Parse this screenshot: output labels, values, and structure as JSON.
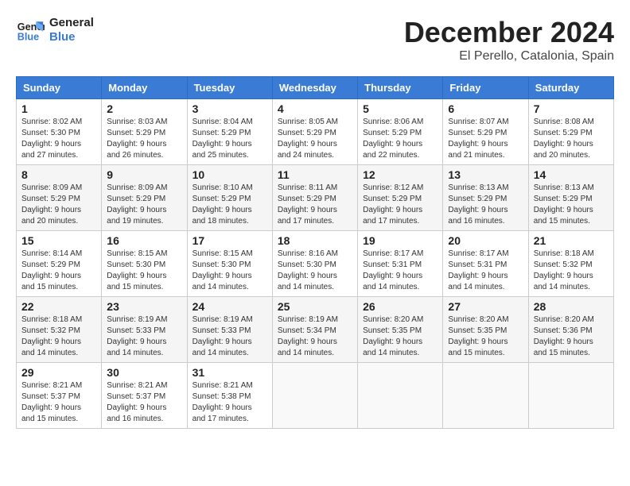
{
  "logo": {
    "line1": "General",
    "line2": "Blue"
  },
  "header": {
    "month": "December 2024",
    "location": "El Perello, Catalonia, Spain"
  },
  "weekdays": [
    "Sunday",
    "Monday",
    "Tuesday",
    "Wednesday",
    "Thursday",
    "Friday",
    "Saturday"
  ],
  "weeks": [
    [
      {
        "day": "1",
        "sunrise": "8:02 AM",
        "sunset": "5:30 PM",
        "daylight": "9 hours and 27 minutes."
      },
      {
        "day": "2",
        "sunrise": "8:03 AM",
        "sunset": "5:29 PM",
        "daylight": "9 hours and 26 minutes."
      },
      {
        "day": "3",
        "sunrise": "8:04 AM",
        "sunset": "5:29 PM",
        "daylight": "9 hours and 25 minutes."
      },
      {
        "day": "4",
        "sunrise": "8:05 AM",
        "sunset": "5:29 PM",
        "daylight": "9 hours and 24 minutes."
      },
      {
        "day": "5",
        "sunrise": "8:06 AM",
        "sunset": "5:29 PM",
        "daylight": "9 hours and 22 minutes."
      },
      {
        "day": "6",
        "sunrise": "8:07 AM",
        "sunset": "5:29 PM",
        "daylight": "9 hours and 21 minutes."
      },
      {
        "day": "7",
        "sunrise": "8:08 AM",
        "sunset": "5:29 PM",
        "daylight": "9 hours and 20 minutes."
      }
    ],
    [
      {
        "day": "8",
        "sunrise": "8:09 AM",
        "sunset": "5:29 PM",
        "daylight": "9 hours and 20 minutes."
      },
      {
        "day": "9",
        "sunrise": "8:09 AM",
        "sunset": "5:29 PM",
        "daylight": "9 hours and 19 minutes."
      },
      {
        "day": "10",
        "sunrise": "8:10 AM",
        "sunset": "5:29 PM",
        "daylight": "9 hours and 18 minutes."
      },
      {
        "day": "11",
        "sunrise": "8:11 AM",
        "sunset": "5:29 PM",
        "daylight": "9 hours and 17 minutes."
      },
      {
        "day": "12",
        "sunrise": "8:12 AM",
        "sunset": "5:29 PM",
        "daylight": "9 hours and 17 minutes."
      },
      {
        "day": "13",
        "sunrise": "8:13 AM",
        "sunset": "5:29 PM",
        "daylight": "9 hours and 16 minutes."
      },
      {
        "day": "14",
        "sunrise": "8:13 AM",
        "sunset": "5:29 PM",
        "daylight": "9 hours and 15 minutes."
      }
    ],
    [
      {
        "day": "15",
        "sunrise": "8:14 AM",
        "sunset": "5:29 PM",
        "daylight": "9 hours and 15 minutes."
      },
      {
        "day": "16",
        "sunrise": "8:15 AM",
        "sunset": "5:30 PM",
        "daylight": "9 hours and 15 minutes."
      },
      {
        "day": "17",
        "sunrise": "8:15 AM",
        "sunset": "5:30 PM",
        "daylight": "9 hours and 14 minutes."
      },
      {
        "day": "18",
        "sunrise": "8:16 AM",
        "sunset": "5:30 PM",
        "daylight": "9 hours and 14 minutes."
      },
      {
        "day": "19",
        "sunrise": "8:17 AM",
        "sunset": "5:31 PM",
        "daylight": "9 hours and 14 minutes."
      },
      {
        "day": "20",
        "sunrise": "8:17 AM",
        "sunset": "5:31 PM",
        "daylight": "9 hours and 14 minutes."
      },
      {
        "day": "21",
        "sunrise": "8:18 AM",
        "sunset": "5:32 PM",
        "daylight": "9 hours and 14 minutes."
      }
    ],
    [
      {
        "day": "22",
        "sunrise": "8:18 AM",
        "sunset": "5:32 PM",
        "daylight": "9 hours and 14 minutes."
      },
      {
        "day": "23",
        "sunrise": "8:19 AM",
        "sunset": "5:33 PM",
        "daylight": "9 hours and 14 minutes."
      },
      {
        "day": "24",
        "sunrise": "8:19 AM",
        "sunset": "5:33 PM",
        "daylight": "9 hours and 14 minutes."
      },
      {
        "day": "25",
        "sunrise": "8:19 AM",
        "sunset": "5:34 PM",
        "daylight": "9 hours and 14 minutes."
      },
      {
        "day": "26",
        "sunrise": "8:20 AM",
        "sunset": "5:35 PM",
        "daylight": "9 hours and 14 minutes."
      },
      {
        "day": "27",
        "sunrise": "8:20 AM",
        "sunset": "5:35 PM",
        "daylight": "9 hours and 15 minutes."
      },
      {
        "day": "28",
        "sunrise": "8:20 AM",
        "sunset": "5:36 PM",
        "daylight": "9 hours and 15 minutes."
      }
    ],
    [
      {
        "day": "29",
        "sunrise": "8:21 AM",
        "sunset": "5:37 PM",
        "daylight": "9 hours and 15 minutes."
      },
      {
        "day": "30",
        "sunrise": "8:21 AM",
        "sunset": "5:37 PM",
        "daylight": "9 hours and 16 minutes."
      },
      {
        "day": "31",
        "sunrise": "8:21 AM",
        "sunset": "5:38 PM",
        "daylight": "9 hours and 17 minutes."
      },
      null,
      null,
      null,
      null
    ]
  ],
  "labels": {
    "sunrise": "Sunrise:",
    "sunset": "Sunset:",
    "daylight": "Daylight:"
  }
}
